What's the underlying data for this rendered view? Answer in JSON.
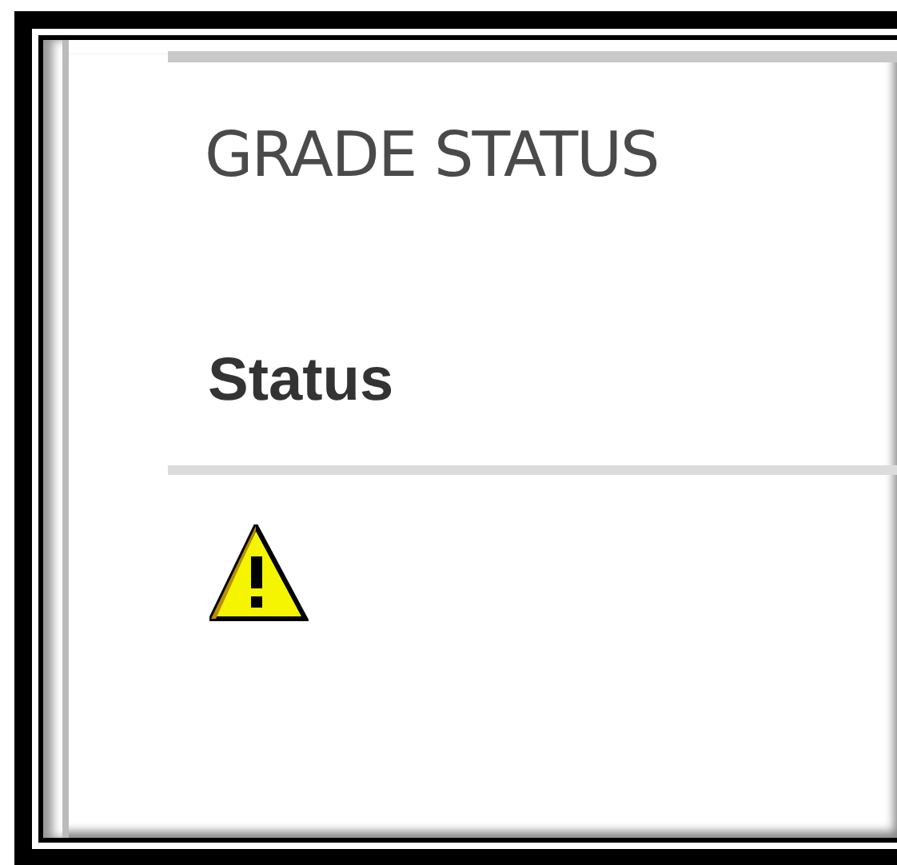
{
  "section": {
    "title": "GRADE STATUS"
  },
  "table": {
    "columns": [
      "Status"
    ],
    "rows": [
      {
        "status": {
          "kind": "warning"
        }
      }
    ]
  }
}
